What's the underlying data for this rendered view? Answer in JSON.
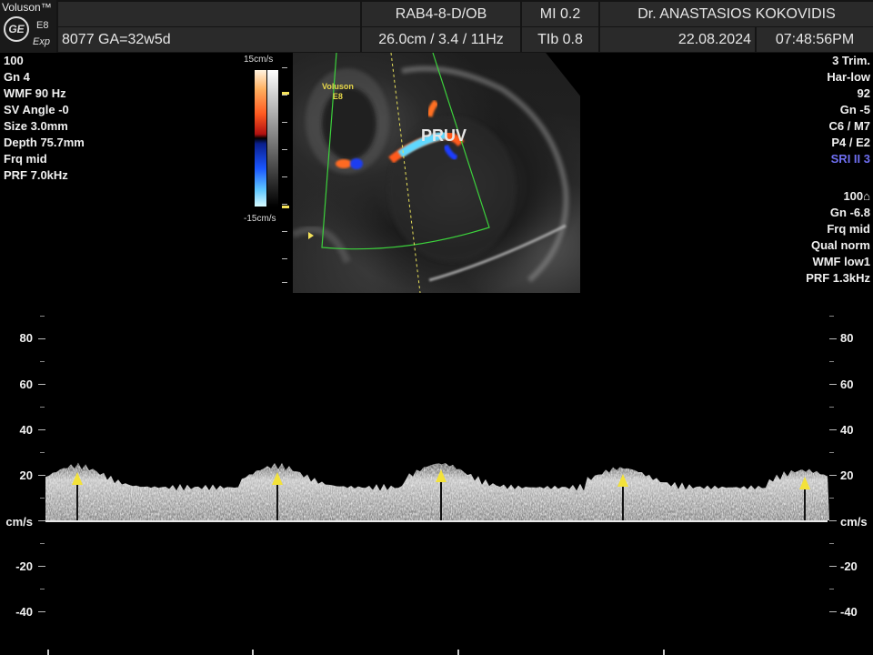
{
  "header": {
    "brand": "Voluson™",
    "logo": "GE",
    "model": "E8",
    "edition": "Exp",
    "probe": "RAB4-8-D/OB",
    "mi": "MI  0.2",
    "doctor": "Dr. ANASTASIOS KOKOVIDIS",
    "patient": "8077  GA=32w5d",
    "depth_freq": "26.0cm / 3.4 / 11Hz",
    "tib": "TIb  0.8",
    "date": "22.08.2024",
    "time": "07:48:56PM"
  },
  "left_params": [
    "100",
    "Gn   4",
    "WMF 90 Hz",
    "SV Angle -0",
    "Size  3.0mm",
    "Depth 75.7mm",
    "Frq mid",
    "PRF  7.0kHz"
  ],
  "right_params_top": [
    "3 Trim.",
    "Har-low",
    "92",
    "Gn  -5",
    "C6 / M7",
    "P4 / E2"
  ],
  "right_sri": "SRI II 3",
  "right_params_bottom": [
    "100⌂",
    "Gn -6.8",
    "Frq mid",
    "Qual norm",
    "WMF low1",
    "PRF  1.3kHz"
  ],
  "color_scale": {
    "top": "15cm/s",
    "bottom": "-15cm/s"
  },
  "image": {
    "logo_line1": "Voluson",
    "logo_line2": "E8",
    "vessel_label": "PRUV"
  },
  "spectral": {
    "unit": "cm/s",
    "ticks": [
      80,
      60,
      40,
      20,
      -20,
      -40
    ],
    "range": [
      -50,
      94
    ],
    "peaks": [
      19,
      19,
      20,
      18,
      17
    ]
  },
  "colors": {
    "marker": "#f3e23a",
    "sri": "#6f6ff2",
    "header": "#2a2a2a"
  }
}
